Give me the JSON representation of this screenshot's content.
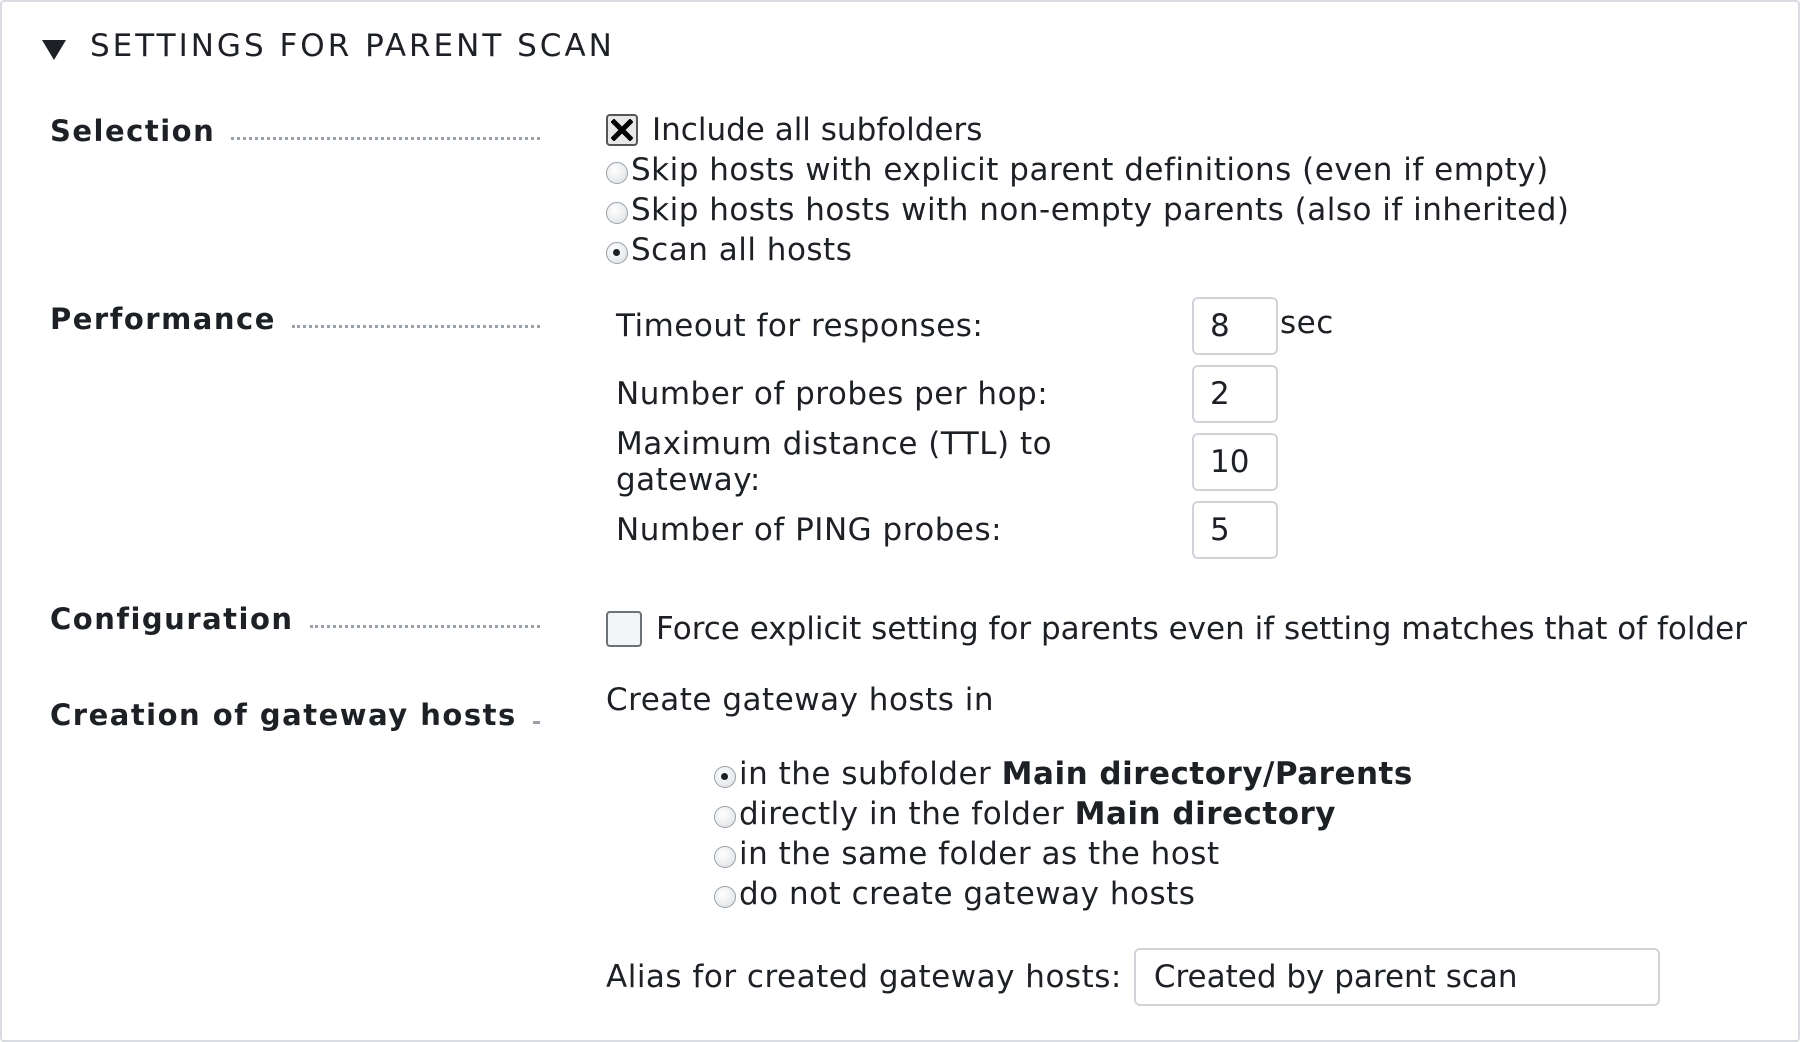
{
  "header": {
    "title": "SETTINGS FOR PARENT SCAN"
  },
  "selection": {
    "label": "Selection",
    "include_subfolders": {
      "label": "Include all subfolders",
      "checked": true
    },
    "options": [
      {
        "label": "Skip hosts with explicit parent definitions (even if empty)",
        "selected": false
      },
      {
        "label": "Skip hosts hosts with non-empty parents (also if inherited)",
        "selected": false
      },
      {
        "label": "Scan all hosts",
        "selected": true
      }
    ]
  },
  "performance": {
    "label": "Performance",
    "fields": [
      {
        "label": "Timeout for responses:",
        "value": "8",
        "unit": "sec"
      },
      {
        "label": "Number of probes per hop:",
        "value": "2",
        "unit": ""
      },
      {
        "label": "Maximum distance (TTL) to gateway:",
        "value": "10",
        "unit": ""
      },
      {
        "label": "Number of PING probes:",
        "value": "5",
        "unit": ""
      }
    ]
  },
  "configuration": {
    "label": "Configuration",
    "force_explicit": {
      "label": "Force explicit setting for parents even if setting matches that of folder",
      "checked": false
    }
  },
  "gateway": {
    "label": "Creation of gateway hosts",
    "intro": "Create gateway hosts in",
    "options": [
      {
        "prefix": "in the subfolder ",
        "bold": "Main directory/Parents",
        "selected": true
      },
      {
        "prefix": "directly in the folder ",
        "bold": "Main directory",
        "selected": false
      },
      {
        "prefix": "in the same folder as the host",
        "bold": "",
        "selected": false
      },
      {
        "prefix": "do not create gateway hosts",
        "bold": "",
        "selected": false
      }
    ],
    "alias_label": "Alias for created gateway hosts:",
    "alias_value": "Created by parent scan"
  }
}
